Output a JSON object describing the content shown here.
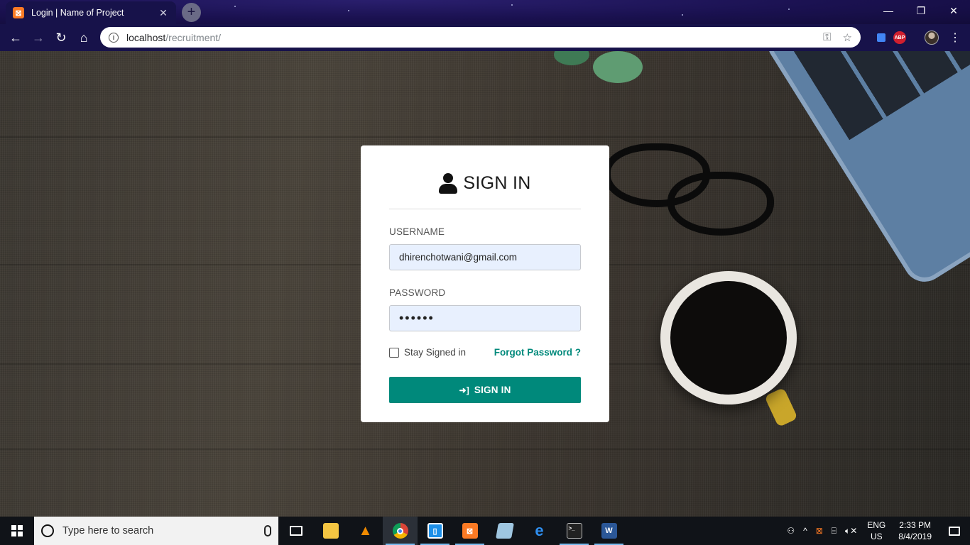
{
  "browser": {
    "tab_title": "Login | Name of Project",
    "tab_favicon": "xampp-icon",
    "url_host": "localhost",
    "url_path": "/recruitment/",
    "abp_label": "ABP"
  },
  "login": {
    "heading": "SIGN IN",
    "username_label": "USERNAME",
    "username_value": "dhirenchotwani@gmail.com",
    "password_label": "PASSWORD",
    "password_value": "••••••",
    "stay_signed_in": "Stay Signed in",
    "stay_signed_in_checked": false,
    "forgot_password": "Forgot Password ?",
    "submit_label": "SIGN IN",
    "accent_color": "#00897b"
  },
  "taskbar": {
    "search_placeholder": "Type here to search",
    "language": "ENG",
    "region": "US",
    "time": "2:33 PM",
    "date": "8/4/2019",
    "pinned": [
      "task-view",
      "file-explorer",
      "vlc",
      "chrome",
      "jetbrains",
      "xampp",
      "notepad",
      "edge",
      "terminal",
      "word"
    ]
  }
}
